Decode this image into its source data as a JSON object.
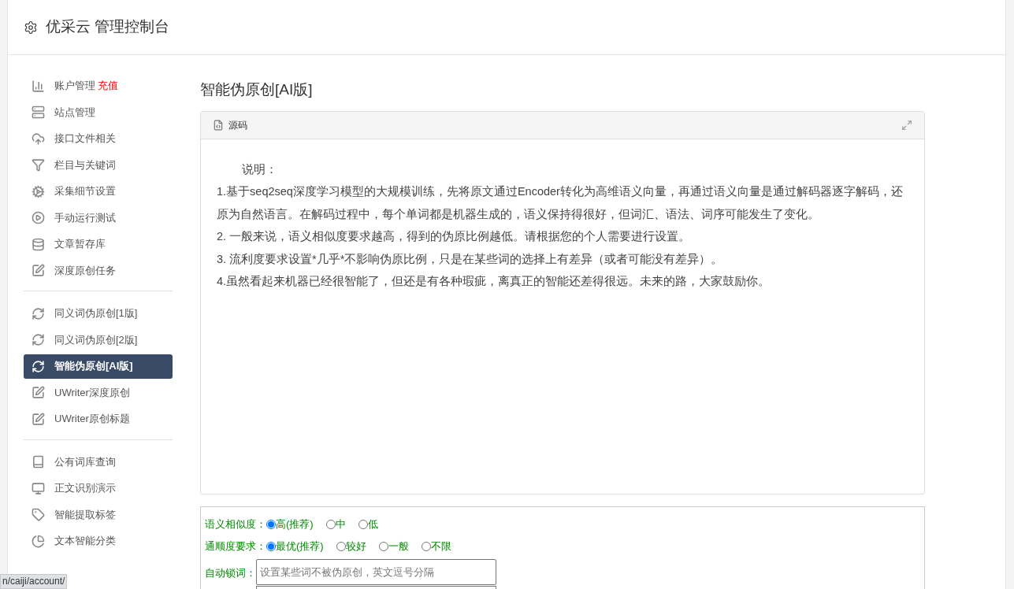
{
  "header": {
    "title": "优采云 管理控制台"
  },
  "sidebar": {
    "groups": [
      {
        "items": [
          {
            "label": "账户管理",
            "badge": "充值",
            "selected": false
          },
          {
            "label": "站点管理",
            "selected": false
          },
          {
            "label": "接口文件相关",
            "selected": false
          },
          {
            "label": "栏目与关键词",
            "selected": false
          },
          {
            "label": "采集细节设置",
            "selected": false
          },
          {
            "label": "手动运行测试",
            "selected": false
          },
          {
            "label": "文章暂存库",
            "selected": false
          },
          {
            "label": "深度原创任务",
            "selected": false
          }
        ]
      },
      {
        "items": [
          {
            "label": "同义词伪原创[1版]",
            "selected": false
          },
          {
            "label": "同义词伪原创[2版]",
            "selected": false
          },
          {
            "label": "智能伪原创[AI版]",
            "selected": true
          },
          {
            "label": "UWriter深度原创",
            "selected": false
          },
          {
            "label": "UWriter原创标题",
            "selected": false
          }
        ]
      },
      {
        "items": [
          {
            "label": "公有词库查询",
            "selected": false
          },
          {
            "label": "正文识别演示",
            "selected": false
          },
          {
            "label": "智能提取标签",
            "selected": false
          },
          {
            "label": "文本智能分类",
            "selected": false
          }
        ]
      }
    ]
  },
  "page_title": "智能伪原创[AI版]",
  "editor": {
    "tab": "源码",
    "lines": [
      "说明：",
      "1.基于seq2seq深度学习模型的大规模训练，先将原文通过Encoder转化为高维语义向量，再通过语义向量是通过解码器逐字解码，还原为自然语言。在解码过程中，每个单词都是机器生成的，语义保持得很好，但词汇、语法、词序可能发生了变化。",
      "2. 一般来说，语义相似度要求越高，得到的伪原比例越低。请根据您的个人需要进行设置。",
      "3. 流利度要求设置*几乎*不影响伪原比例，只是在某些词的选择上有差异（或者可能没有差异）。",
      "4.虽然看起来机器已经很智能了，但还是有各种瑕疵，离真正的智能还差得很远。未来的路，大家鼓励你。"
    ]
  },
  "options": {
    "radio_groups": [
      {
        "label": "语义相似度：",
        "choices": [
          {
            "label": "高(推荐)",
            "selected": true
          },
          {
            "label": "中",
            "selected": false
          },
          {
            "label": "低",
            "selected": false
          }
        ]
      },
      {
        "label": "通顺度要求：",
        "choices": [
          {
            "label": "最优(推荐)",
            "selected": true
          },
          {
            "label": "较好",
            "selected": false
          },
          {
            "label": "一般",
            "selected": false
          },
          {
            "label": "不限",
            "selected": false
          }
        ]
      }
    ],
    "lock_words": {
      "label": "自动锁词：",
      "placeholder": "设置某些词不被伪原创，英文逗号分隔"
    }
  },
  "status_bar": {
    "url": "n/caiji/account/"
  }
}
